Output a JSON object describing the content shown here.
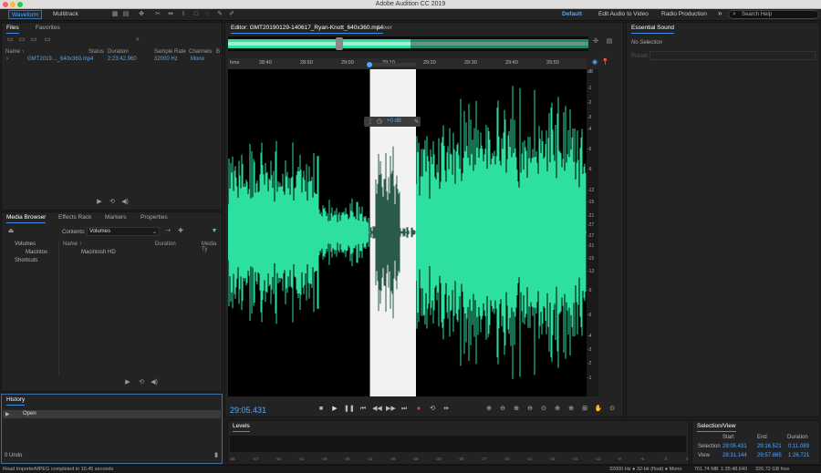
{
  "window": {
    "title": "Adobe Audition CC 2019"
  },
  "toolbar": {
    "waveform_label": "Waveform",
    "multitrack_label": "Multitrack",
    "workspaces": [
      "Default",
      "Edit Audio to Video",
      "Radio Production"
    ],
    "overflow_label": "»",
    "search_placeholder": "Search Help"
  },
  "files_panel": {
    "tabs": [
      "Files",
      "Favorites"
    ],
    "columns": [
      "Name ↑",
      "Status",
      "Duration",
      "Sample Rate",
      "Channels",
      "B"
    ],
    "rows": [
      {
        "name": "GMT2019…_640x360.mp4",
        "duration": "2:23:42.960",
        "sample_rate": "32000 Hz",
        "channels": "Mono"
      }
    ]
  },
  "media_panel": {
    "tabs": [
      "Media Browser",
      "Effects Rack",
      "Markers",
      "Properties"
    ],
    "contents_label": "Contents:",
    "contents_value": "Volumes",
    "tree": [
      "Volumes",
      "Macintos",
      "Shortcuts"
    ],
    "columns": [
      "Name ↑",
      "Duration",
      "Media Ty"
    ],
    "items": [
      "Macintosh HD"
    ]
  },
  "history_panel": {
    "tab": "History",
    "items": [
      "Open"
    ],
    "undo_count": "0 Undo"
  },
  "editor": {
    "tab": "Editor: GMT20190129-140617_Ryan-Knott_640x360.mp4",
    "mixer_tab": "Mixer",
    "ruler_unit": "hms",
    "ruler_ticks": [
      "28:40",
      "28:50",
      "29:00",
      "29:10",
      "29:20",
      "29:30",
      "29:40",
      "29:50"
    ],
    "db_labels": [
      "dB",
      "-1",
      "-2",
      "-3",
      "-4",
      "-6",
      "-9",
      "-12",
      "-15",
      "-21",
      "-27",
      "-27",
      "-21",
      "-15",
      "-12",
      "-9",
      "-6",
      "-4",
      "-3",
      "-2",
      "-1"
    ],
    "hud_gain": "+0 dB",
    "time_display": "29:05.431"
  },
  "essential_sound": {
    "tab": "Essential Sound",
    "no_selection": "No Selection",
    "preset_label": "Preset:"
  },
  "levels": {
    "tab": "Levels",
    "scale": [
      "dB",
      "-57",
      "-54",
      "-51",
      "-48",
      "-45",
      "-42",
      "-39",
      "-36",
      "-33",
      "-30",
      "-27",
      "-24",
      "-21",
      "-18",
      "-15",
      "-12",
      "-9",
      "-6",
      "-3",
      "0"
    ]
  },
  "selection_view": {
    "tab": "Selection/View",
    "headers": [
      "Start",
      "End",
      "Duration"
    ],
    "selection": {
      "label": "Selection",
      "start": "29:05.431",
      "end": "29:16.521",
      "duration": "0:11.089"
    },
    "view": {
      "label": "View",
      "start": "28:31.144",
      "end": "29:57.865",
      "duration": "1:26.721"
    }
  },
  "status": {
    "message": "Read ImporterMPEG completed in 10.45 seconds",
    "format": "32000 Hz ● 32-bit (float) ● Mono",
    "file_size": "701.74 MB",
    "duration": "1:35:48.640",
    "free": "326.72 GB free"
  },
  "colors": {
    "waveform": "#2de0a0",
    "accent": "#4fa8ff",
    "playhead": "#e0404a"
  }
}
